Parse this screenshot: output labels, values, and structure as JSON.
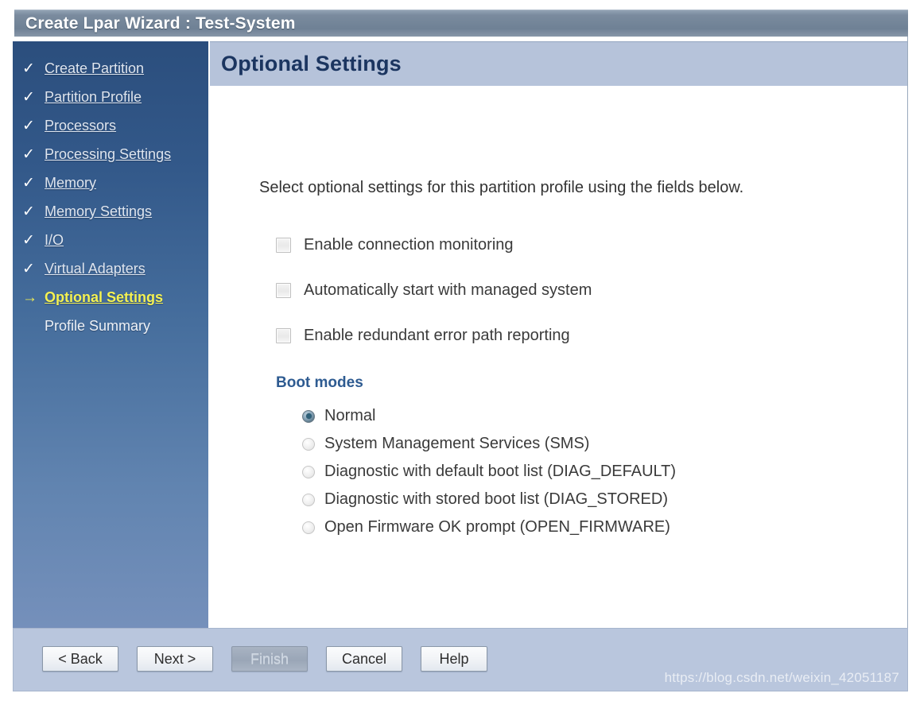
{
  "window": {
    "title": "Create Lpar Wizard : Test-System"
  },
  "sidebar": {
    "items": [
      {
        "label": "Create Partition",
        "marker": "check",
        "state": "completed"
      },
      {
        "label": "Partition Profile",
        "marker": "check",
        "state": "completed"
      },
      {
        "label": "Processors",
        "marker": "check",
        "state": "completed"
      },
      {
        "label": "Processing Settings",
        "marker": "check",
        "state": "completed"
      },
      {
        "label": "Memory",
        "marker": "check",
        "state": "completed"
      },
      {
        "label": "Memory Settings",
        "marker": "check",
        "state": "completed"
      },
      {
        "label": "I/O",
        "marker": "check",
        "state": "completed"
      },
      {
        "label": "Virtual Adapters",
        "marker": "check",
        "state": "completed"
      },
      {
        "label": "Optional Settings",
        "marker": "arrow",
        "state": "current"
      },
      {
        "label": "Profile Summary",
        "marker": "none",
        "state": "upcoming"
      }
    ],
    "marker_glyphs": {
      "check": "✓",
      "arrow": "→",
      "none": ""
    },
    "colors": {
      "background_top": "#2b4e7d",
      "background_bottom": "#7590bb",
      "current_text": "#f4f152",
      "link_text": "#dfe6f0"
    }
  },
  "main": {
    "page_title": "Optional Settings",
    "intro_text": "Select optional settings for this partition profile using the fields below.",
    "checkboxes": [
      {
        "label": "Enable connection monitoring",
        "checked": false
      },
      {
        "label": "Automatically start with managed system",
        "checked": false
      },
      {
        "label": "Enable redundant error path reporting",
        "checked": false
      }
    ],
    "boot_modes": {
      "heading": "Boot modes",
      "options": [
        {
          "label": "Normal",
          "selected": true
        },
        {
          "label": "System Management Services (SMS)",
          "selected": false
        },
        {
          "label": "Diagnostic with default boot list (DIAG_DEFAULT)",
          "selected": false
        },
        {
          "label": "Diagnostic with stored boot list (DIAG_STORED)",
          "selected": false
        },
        {
          "label": "Open Firmware OK prompt (OPEN_FIRMWARE)",
          "selected": false
        }
      ],
      "heading_color": "#2e5b91"
    },
    "header_color": "#b6c3da",
    "title_color": "#1b3560"
  },
  "footer": {
    "buttons": [
      {
        "label": "< Back",
        "disabled": false
      },
      {
        "label": "Next >",
        "disabled": false
      },
      {
        "label": "Finish",
        "disabled": true
      },
      {
        "label": "Cancel",
        "disabled": false
      },
      {
        "label": "Help",
        "disabled": false
      }
    ],
    "watermark": "https://blog.csdn.net/weixin_42051187",
    "background_color": "#b9c6dd"
  }
}
